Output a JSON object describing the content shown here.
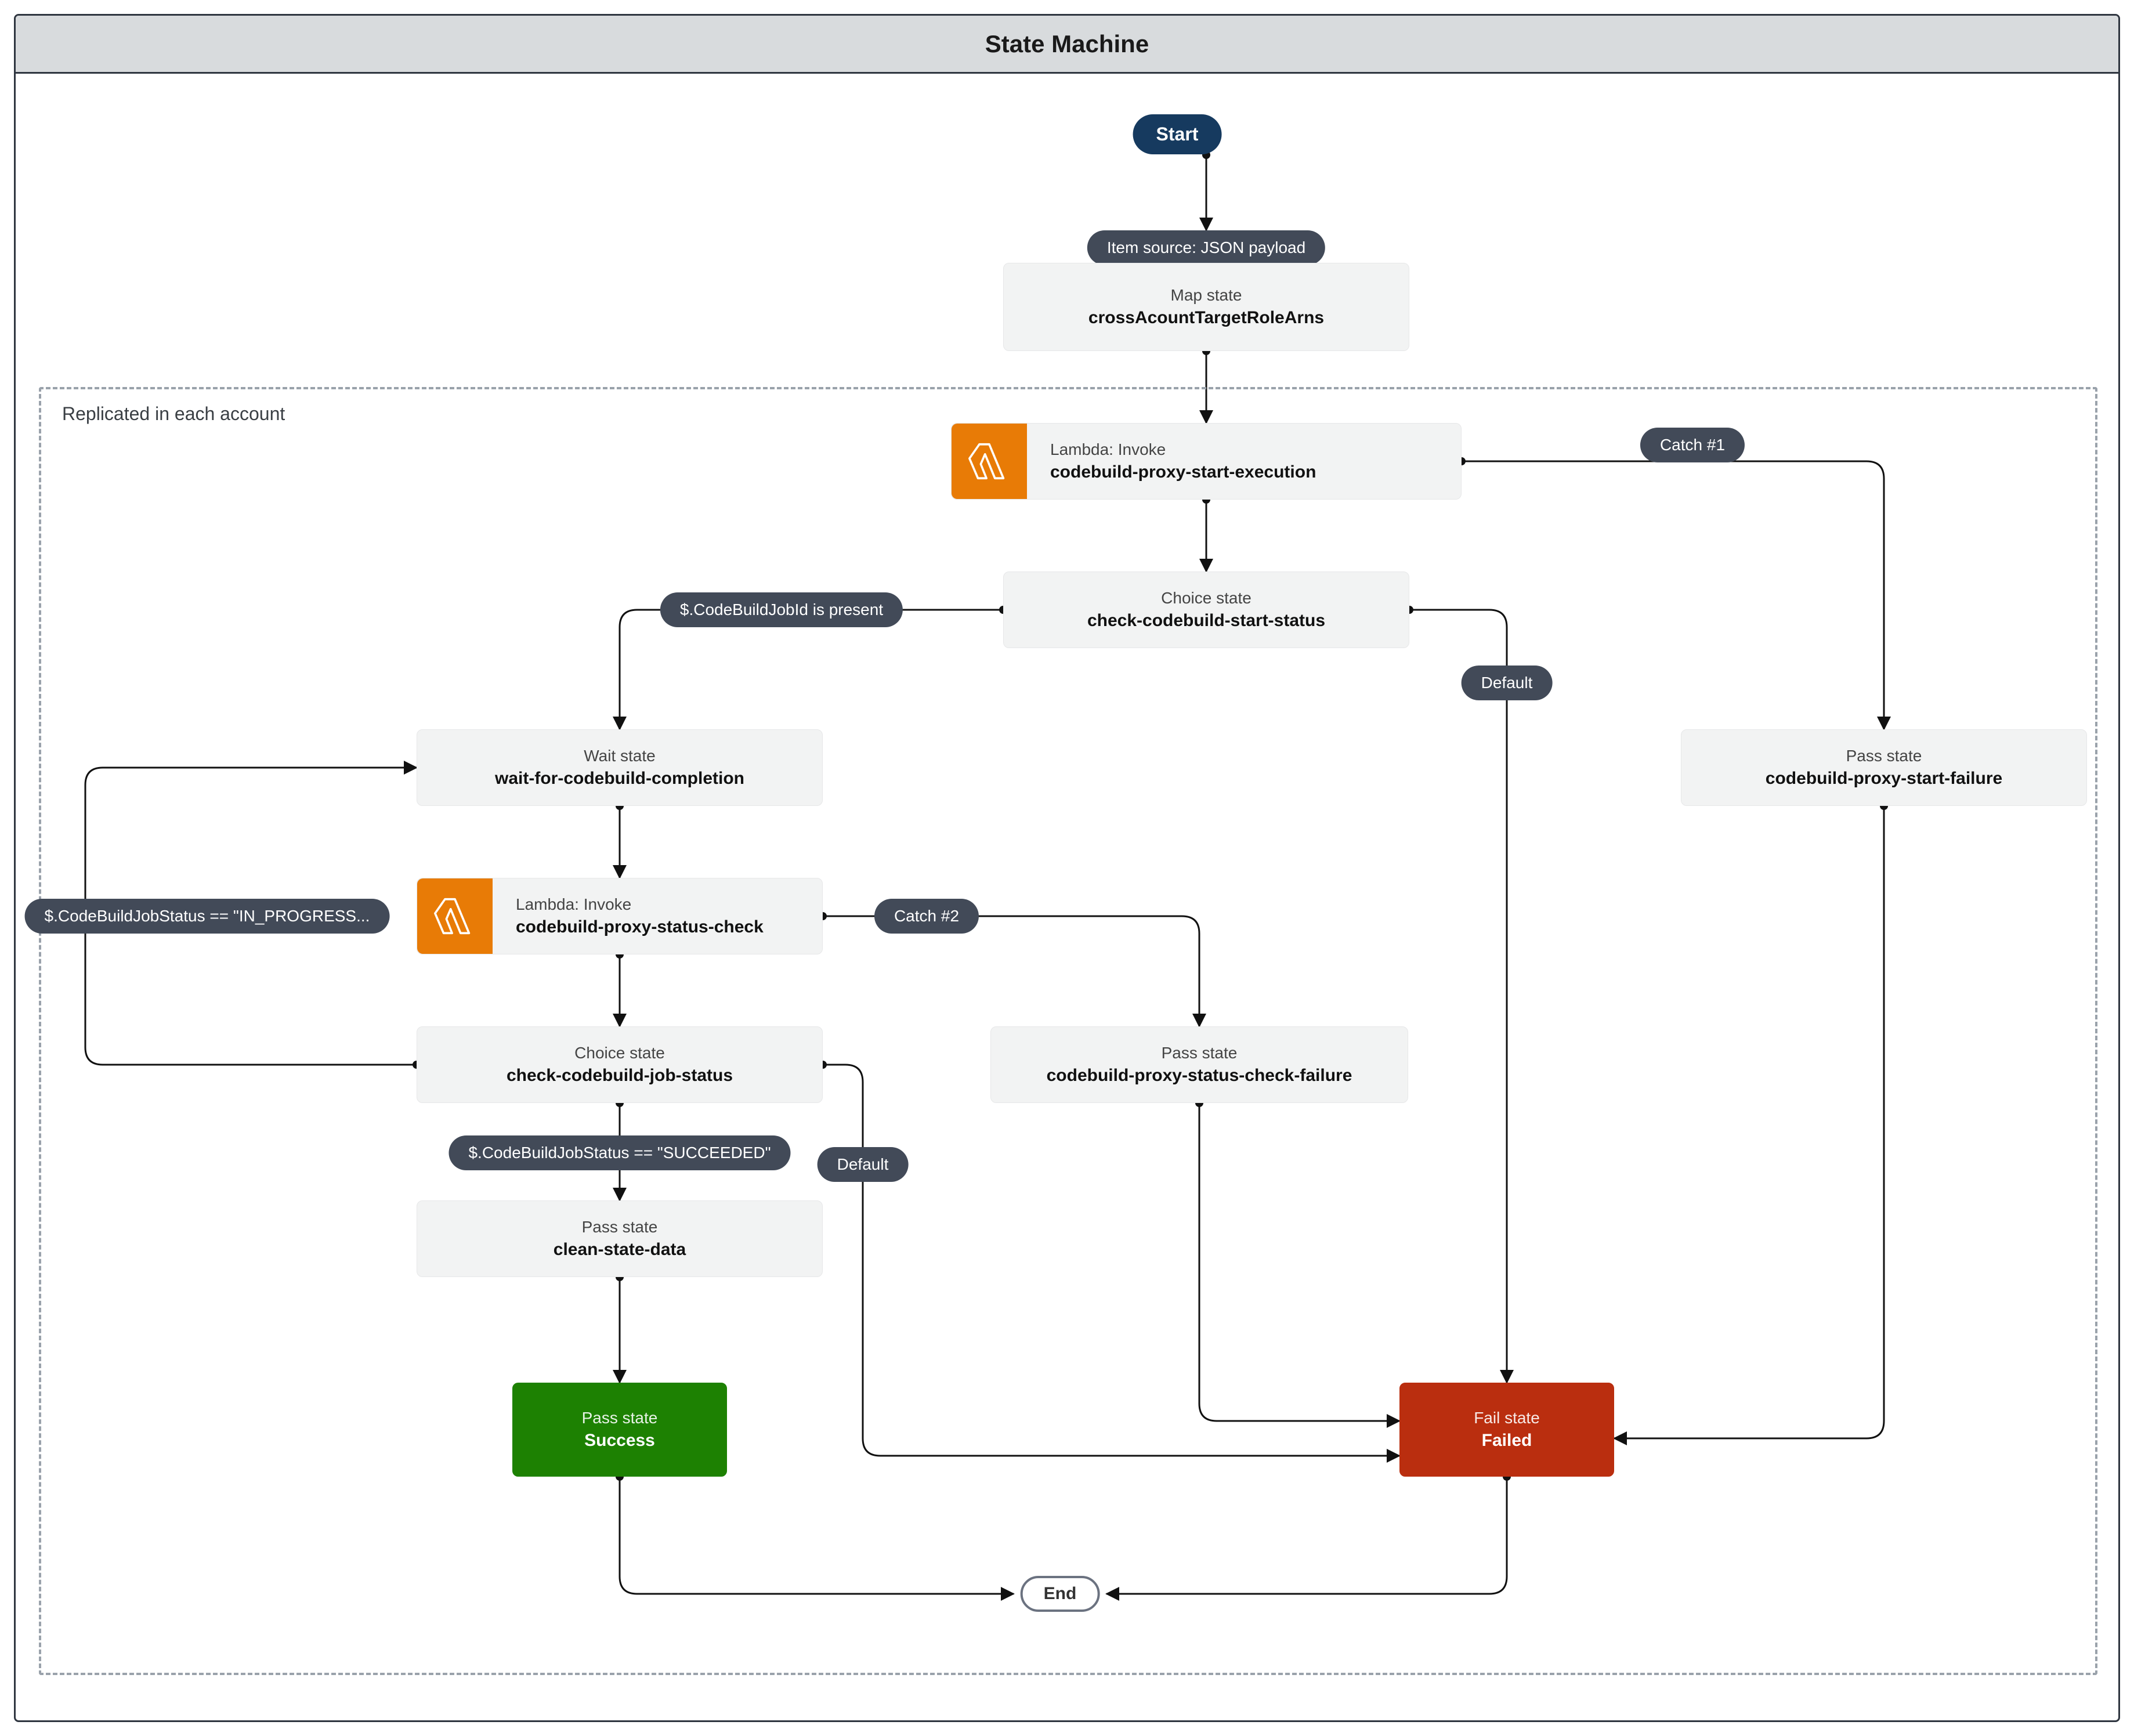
{
  "title": "State Machine",
  "group_label": "Replicated in each account",
  "start_label": "Start",
  "end_label": "End",
  "pills": {
    "item_source": "Item source: JSON payload",
    "catch1": "Catch #1",
    "catch2": "Catch #2",
    "default": "Default",
    "default2": "Default",
    "jobid_present": "$.CodeBuildJobId is present",
    "status_in_progress": "$.CodeBuildJobStatus == \"IN_PROGRESS...",
    "status_succeeded": "$.CodeBuildJobStatus == \"SUCCEEDED\""
  },
  "states": {
    "map": {
      "type": "Map state",
      "name": "crossAcountTargetRoleArns"
    },
    "start_exec": {
      "type": "Lambda: Invoke",
      "name": "codebuild-proxy-start-execution"
    },
    "check_start": {
      "type": "Choice state",
      "name": "check-codebuild-start-status"
    },
    "wait": {
      "type": "Wait state",
      "name": "wait-for-codebuild-completion"
    },
    "status_check": {
      "type": "Lambda: Invoke",
      "name": "codebuild-proxy-status-check"
    },
    "check_job": {
      "type": "Choice state",
      "name": "check-codebuild-job-status"
    },
    "clean": {
      "type": "Pass state",
      "name": "clean-state-data"
    },
    "success": {
      "type": "Pass state",
      "name": "Success"
    },
    "start_failure": {
      "type": "Pass state",
      "name": "codebuild-proxy-start-failure"
    },
    "status_failure": {
      "type": "Pass state",
      "name": "codebuild-proxy-status-check-failure"
    },
    "failed": {
      "type": "Fail state",
      "name": "Failed"
    }
  }
}
